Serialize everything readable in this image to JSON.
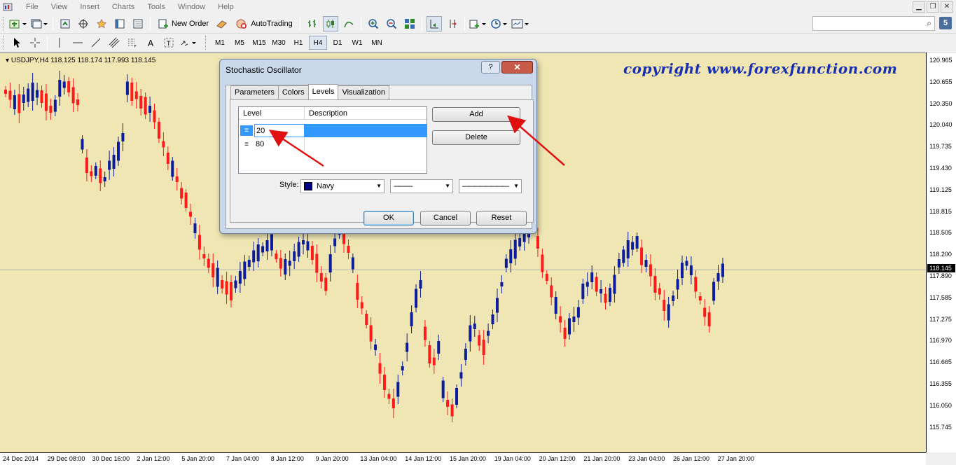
{
  "menubar": {
    "items": [
      "File",
      "View",
      "Insert",
      "Charts",
      "Tools",
      "Window",
      "Help"
    ]
  },
  "toolbar": {
    "new_order_label": "New Order",
    "autotrading_label": "AutoTrading",
    "timeframes": [
      "M1",
      "M5",
      "M15",
      "M30",
      "H1",
      "H4",
      "D1",
      "W1",
      "MN"
    ],
    "active_timeframe": "H4",
    "badge": "5"
  },
  "chart": {
    "symbol_info": "USDJPY,H4  118.125 118.174 117.993 118.145",
    "copyright": "copyright www.forexfunction.com",
    "current_price": "118.145",
    "price_ticks": [
      "120.965",
      "120.655",
      "120.350",
      "120.040",
      "119.735",
      "119.430",
      "119.125",
      "118.815",
      "118.505",
      "118.200",
      "117.890",
      "117.585",
      "117.275",
      "116.970",
      "116.665",
      "116.355",
      "116.050",
      "115.745"
    ],
    "time_ticks": [
      "24 Dec 2014",
      "29 Dec 08:00",
      "30 Dec 16:00",
      "2 Jan 12:00",
      "5 Jan 20:00",
      "7 Jan 04:00",
      "8 Jan 12:00",
      "9 Jan 20:00",
      "13 Jan 04:00",
      "14 Jan 12:00",
      "15 Jan 20:00",
      "19 Jan 04:00",
      "20 Jan 12:00",
      "21 Jan 20:00",
      "23 Jan 04:00",
      "26 Jan 12:00",
      "27 Jan 20:00"
    ],
    "colors": {
      "background": "#efe6b3",
      "bull": "#0b1d9c",
      "bear": "#ff1a1a"
    }
  },
  "dialog": {
    "title": "Stochastic Oscillator",
    "help_label": "?",
    "close_label": "✕",
    "tabs": [
      "Parameters",
      "Colors",
      "Levels",
      "Visualization"
    ],
    "active_tab": "Levels",
    "levels_table": {
      "columns": [
        "Level",
        "Description"
      ],
      "rows": [
        {
          "level": "20",
          "description": ""
        },
        {
          "level": "80",
          "description": ""
        }
      ]
    },
    "add_label": "Add",
    "delete_label": "Delete",
    "style_label": "Style:",
    "color_value": "Navy",
    "line_style_value": "----------",
    "line_width_value": "————————",
    "ok_label": "OK",
    "cancel_label": "Cancel",
    "reset_label": "Reset"
  }
}
